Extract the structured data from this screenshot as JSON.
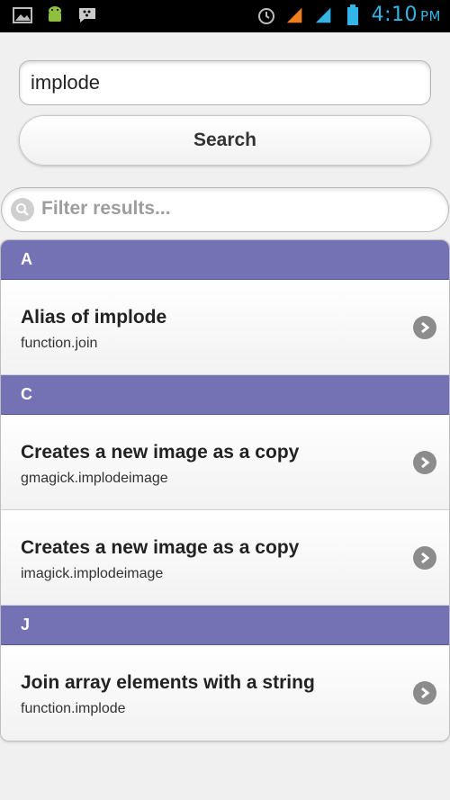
{
  "status_bar": {
    "time": "4:10",
    "ampm": "PM",
    "icons": [
      "image-icon",
      "android-icon",
      "bbm-icon",
      "alarm-icon",
      "signal-1-icon",
      "signal-2-icon",
      "battery-icon"
    ]
  },
  "search": {
    "query": "implode",
    "button_label": "Search"
  },
  "filter": {
    "placeholder": "Filter results..."
  },
  "results": {
    "groups": [
      {
        "letter": "A",
        "items": [
          {
            "title": "Alias of implode",
            "subtitle": "function.join"
          }
        ]
      },
      {
        "letter": "C",
        "items": [
          {
            "title": "Creates a new image as a copy",
            "subtitle": "gmagick.implodeimage"
          },
          {
            "title": "Creates a new image as a copy",
            "subtitle": "imagick.implodeimage"
          }
        ]
      },
      {
        "letter": "J",
        "items": [
          {
            "title": "Join array elements with a string",
            "subtitle": "function.implode"
          }
        ]
      }
    ]
  },
  "colors": {
    "divider": "#7471b4",
    "status_accent": "#33b5e5"
  }
}
